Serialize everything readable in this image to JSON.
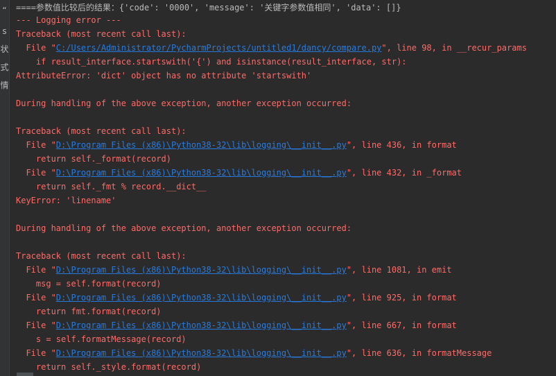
{
  "gutter": {
    "chars": [
      "“",
      "s",
      "状",
      "式",
      "情"
    ]
  },
  "console": {
    "lines": [
      {
        "kind": "out",
        "segments": [
          "====参数值比较后的结果：{'code': '0000', 'message': '关键字参数值相同', 'data': []}"
        ]
      },
      {
        "kind": "err",
        "segments": [
          "--- Logging error ---"
        ]
      },
      {
        "kind": "err",
        "segments": [
          "Traceback (most recent call last):"
        ]
      },
      {
        "kind": "err",
        "segments": [
          "  File \"",
          "C:/Users/Administrator/PycharmProjects/untitled1/dancy/compare.py",
          "\", line 98, in __recur_params"
        ],
        "link": 1
      },
      {
        "kind": "err",
        "segments": [
          "    if result_interface.startswith('{') and isinstance(result_interface, str):"
        ]
      },
      {
        "kind": "err",
        "segments": [
          "AttributeError: 'dict' object has no attribute 'startswith'"
        ]
      },
      {
        "kind": "err",
        "segments": [
          ""
        ]
      },
      {
        "kind": "err",
        "segments": [
          "During handling of the above exception, another exception occurred:"
        ]
      },
      {
        "kind": "err",
        "segments": [
          ""
        ]
      },
      {
        "kind": "err",
        "segments": [
          "Traceback (most recent call last):"
        ]
      },
      {
        "kind": "err",
        "segments": [
          "  File \"",
          "D:\\Program Files (x86)\\Python38-32\\lib\\logging\\__init__.py",
          "\", line 436, in format"
        ],
        "link": 1
      },
      {
        "kind": "err",
        "segments": [
          "    return self._format(record)"
        ]
      },
      {
        "kind": "err",
        "segments": [
          "  File \"",
          "D:\\Program Files (x86)\\Python38-32\\lib\\logging\\__init__.py",
          "\", line 432, in _format"
        ],
        "link": 1
      },
      {
        "kind": "err",
        "segments": [
          "    return self._fmt % record.__dict__"
        ]
      },
      {
        "kind": "err",
        "segments": [
          "KeyError: 'linename'"
        ]
      },
      {
        "kind": "err",
        "segments": [
          ""
        ]
      },
      {
        "kind": "err",
        "segments": [
          "During handling of the above exception, another exception occurred:"
        ]
      },
      {
        "kind": "err",
        "segments": [
          ""
        ]
      },
      {
        "kind": "err",
        "segments": [
          "Traceback (most recent call last):"
        ]
      },
      {
        "kind": "err",
        "segments": [
          "  File \"",
          "D:\\Program Files (x86)\\Python38-32\\lib\\logging\\__init__.py",
          "\", line 1081, in emit"
        ],
        "link": 1
      },
      {
        "kind": "err",
        "segments": [
          "    msg = self.format(record)"
        ]
      },
      {
        "kind": "err",
        "segments": [
          "  File \"",
          "D:\\Program Files (x86)\\Python38-32\\lib\\logging\\__init__.py",
          "\", line 925, in format"
        ],
        "link": 1
      },
      {
        "kind": "err",
        "segments": [
          "    return fmt.format(record)"
        ]
      },
      {
        "kind": "err",
        "segments": [
          "  File \"",
          "D:\\Program Files (x86)\\Python38-32\\lib\\logging\\__init__.py",
          "\", line 667, in format"
        ],
        "link": 1
      },
      {
        "kind": "err",
        "segments": [
          "    s = self.formatMessage(record)"
        ]
      },
      {
        "kind": "err",
        "segments": [
          "  File \"",
          "D:\\Program Files (x86)\\Python38-32\\lib\\logging\\__init__.py",
          "\", line 636, in formatMessage"
        ],
        "link": 1
      },
      {
        "kind": "err",
        "segments": [
          "    return self._style.format(record)"
        ]
      }
    ]
  },
  "colors": {
    "background": "#2b2b2b",
    "stdout": "#bbbbbb",
    "stderr": "#ff6b68",
    "link": "#287bde"
  }
}
